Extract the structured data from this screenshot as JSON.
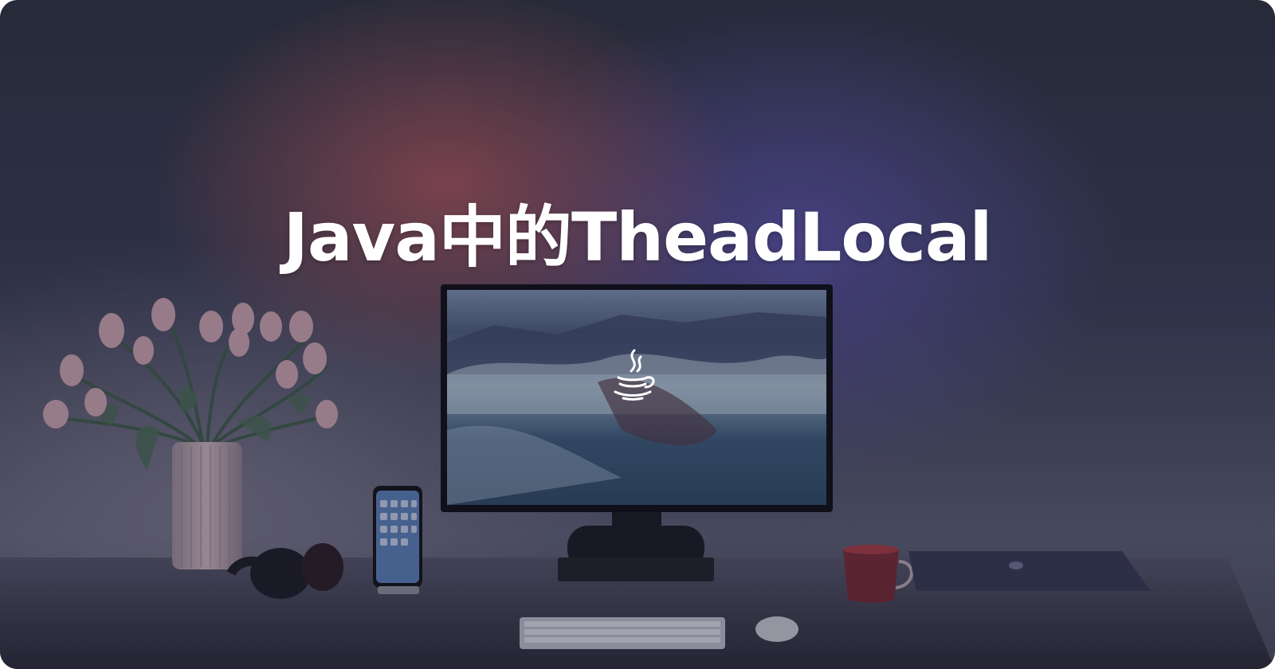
{
  "cover": {
    "title": "Java中的TheadLocal",
    "logo_icon": "java-coffee-cup-icon",
    "accent_colors": {
      "glow_red": "#c45c60",
      "glow_purple": "#5f55af",
      "title": "#ffffff"
    }
  }
}
